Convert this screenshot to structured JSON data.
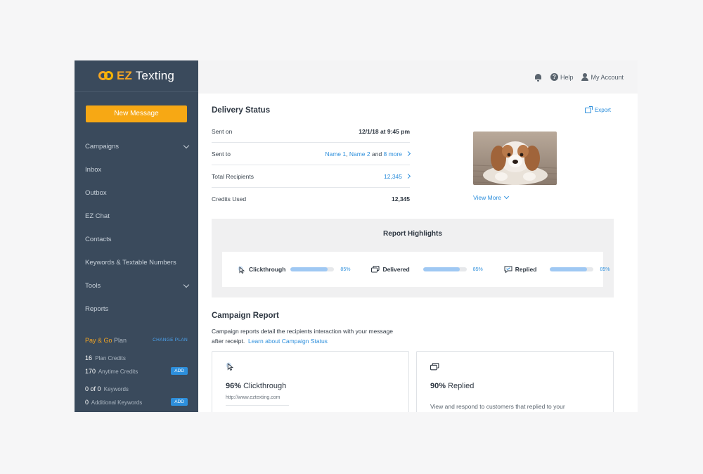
{
  "brand": {
    "prefix": "EZ",
    "name": "Texting"
  },
  "sidebar": {
    "new_message": "New Message",
    "items": [
      {
        "label": "Campaigns",
        "has_chevron": true
      },
      {
        "label": "Inbox"
      },
      {
        "label": "Outbox"
      },
      {
        "label": "EZ Chat"
      },
      {
        "label": "Contacts"
      },
      {
        "label": "Keywords & Textable Numbers"
      },
      {
        "label": "Tools",
        "has_chevron": true
      },
      {
        "label": "Reports"
      }
    ],
    "plan": {
      "name": "Pay & Go",
      "suffix": "Plan",
      "change_label": "CHANGE PLAN",
      "plan_credits_num": "16",
      "plan_credits_label": "Plan Credits",
      "anytime_credits_num": "170",
      "anytime_credits_label": "Anytime Credits",
      "keywords_num": "0 of 0",
      "keywords_label": "Keywords",
      "additional_num": "0",
      "additional_label": "Additional Keywords",
      "add_label": "ADD"
    }
  },
  "topbar": {
    "help": "Help",
    "account": "My Account"
  },
  "delivery": {
    "title": "Delivery Status",
    "export": "Export",
    "sent_on_label": "Sent on",
    "sent_on_value": "12/1/18 at 9:45 pm",
    "sent_to_label": "Sent to",
    "sent_to_name1": "Name 1",
    "sent_to_sep": ", ",
    "sent_to_name2": "Name 2",
    "sent_to_and": " and ",
    "sent_to_more": "8 more",
    "total_label": "Total Recipients",
    "total_value": "12,345",
    "credits_label": "Credits Used",
    "credits_value": "12,345",
    "view_more": "View More"
  },
  "highlights": {
    "title": "Report Highlights",
    "metrics": [
      {
        "label": "Clickthrough",
        "percent": 85,
        "percent_text": "85%",
        "icon": "cursor-icon"
      },
      {
        "label": "Delivered",
        "percent": 85,
        "percent_text": "85%",
        "icon": "messages-icon"
      },
      {
        "label": "Replied",
        "percent": 85,
        "percent_text": "85%",
        "icon": "reply-icon"
      }
    ]
  },
  "campaign": {
    "title": "Campaign Report",
    "desc": "Campaign reports detail the recipients interaction with your message after receipt.",
    "link": "Learn about Campaign Status",
    "cards": [
      {
        "pct": "96%",
        "label": "Clickthrough",
        "sub": "http://www.eztexting.com"
      },
      {
        "pct": "90%",
        "label": "Replied",
        "text": "View and respond to customers that replied to your"
      }
    ]
  },
  "colors": {
    "sidebar": "#3a4a5c",
    "accent": "#f7a814",
    "link": "#2d8fdc",
    "bar_fill": "#9fc8f3"
  }
}
